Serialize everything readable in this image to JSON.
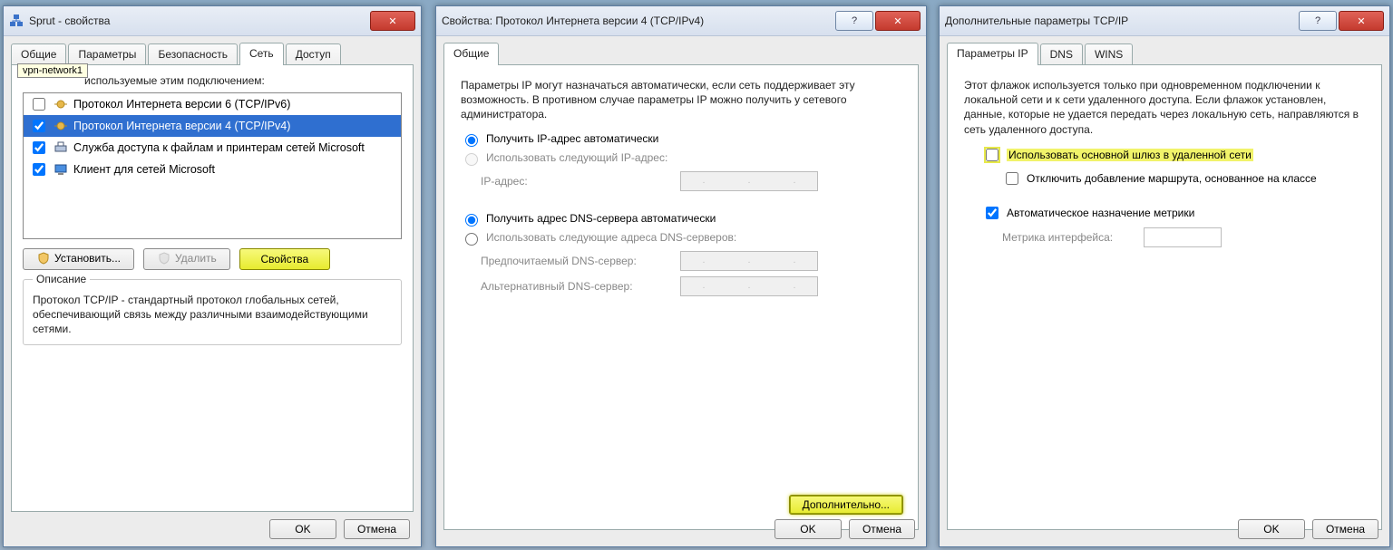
{
  "dlg1": {
    "title": "Sprut - свойства",
    "tabs": {
      "t1": "Общие",
      "t2": "Параметры",
      "t3": "Безопасность",
      "t4": "Сеть",
      "t5": "Доступ"
    },
    "tooltip": "vpn-network1",
    "components_label_tail": "используемые этим подключением:",
    "items": [
      {
        "label": "Протокол Интернета версии 6 (TCP/IPv6)"
      },
      {
        "label": "Протокол Интернета версии 4 (TCP/IPv4)"
      },
      {
        "label": "Служба доступа к файлам и принтерам сетей Microsoft"
      },
      {
        "label": "Клиент для сетей Microsoft"
      }
    ],
    "btn_install": "Установить...",
    "btn_remove": "Удалить",
    "btn_props": "Свойства",
    "desc_legend": "Описание",
    "desc_text": "Протокол TCP/IP - стандартный протокол глобальных сетей, обеспечивающий связь между различными взаимодействующими сетями.",
    "ok": "OK",
    "cancel": "Отмена"
  },
  "dlg2": {
    "title": "Свойства: Протокол Интернета версии 4 (TCP/IPv4)",
    "tab": "Общие",
    "intro": "Параметры IP могут назначаться автоматически, если сеть поддерживает эту возможность. В противном случае параметры IP можно получить у сетевого администратора.",
    "r_ip_auto": "Получить IP-адрес автоматически",
    "r_ip_manual": "Использовать следующий IP-адрес:",
    "ip_lbl": "IP-адрес:",
    "r_dns_auto": "Получить адрес DNS-сервера автоматически",
    "r_dns_manual": "Использовать следующие адреса DNS-серверов:",
    "dns1_lbl": "Предпочитаемый DNS-сервер:",
    "dns2_lbl": "Альтернативный DNS-сервер:",
    "btn_adv": "Дополнительно...",
    "ok": "OK",
    "cancel": "Отмена"
  },
  "dlg3": {
    "title": "Дополнительные параметры TCP/IP",
    "tabs": {
      "t1": "Параметры IP",
      "t2": "DNS",
      "t3": "WINS"
    },
    "intro": "Этот флажок используется только при одновременном подключении к локальной сети и к сети удаленного доступа. Если флажок установлен, данные, которые не удается передать через локальную сеть, направляются в сеть удаленного доступа.",
    "chk_gateway": "Использовать основной шлюз в удаленной сети",
    "chk_classroute": "Отключить добавление маршрута, основанное на классе",
    "chk_autometric": "Автоматическое назначение метрики",
    "metric_lbl": "Метрика интерфейса:",
    "ok": "OK",
    "cancel": "Отмена"
  }
}
